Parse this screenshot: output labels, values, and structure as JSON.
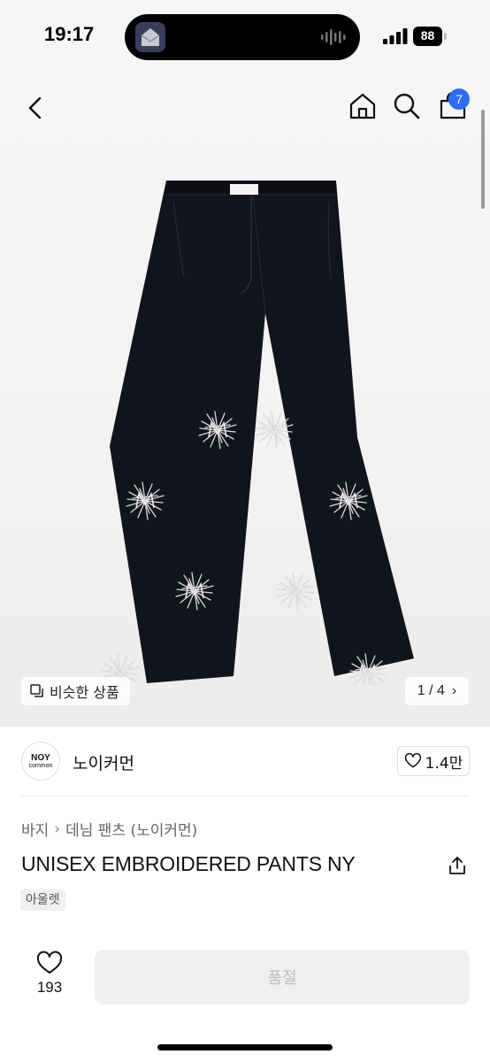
{
  "status_bar": {
    "time": "19:17",
    "battery": "88"
  },
  "nav": {
    "cart_count": "7"
  },
  "gallery": {
    "similar_label": "비슷한 상품",
    "pager_text": "1 / 4",
    "pager_chevron": "›"
  },
  "seller": {
    "logo_top": "NOY",
    "logo_bottom": "common",
    "name": "노이커먼",
    "likes": "1.4만"
  },
  "product": {
    "breadcrumb": [
      "바지",
      "데님 팬츠 (노이커먼)"
    ],
    "breadcrumb_sep": "›",
    "title": "UNISEX EMBROIDERED PANTS NY",
    "tag": "아울렛"
  },
  "bottom_bar": {
    "wish_count": "193",
    "action_label": "품절"
  },
  "colors": {
    "accent": "#2f6cf6",
    "pants": "#12141c",
    "embroidery": "#d9d9d9"
  },
  "icons": [
    "back-chevron-icon",
    "home-icon",
    "search-icon",
    "shopping-bag-icon",
    "copy-icon",
    "heart-icon",
    "share-icon"
  ]
}
